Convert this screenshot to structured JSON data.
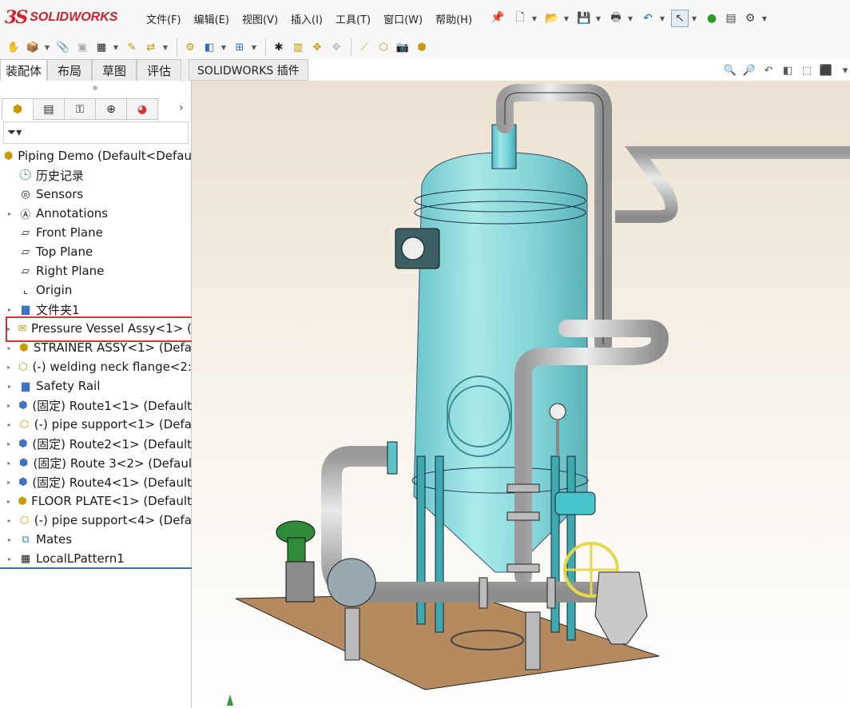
{
  "app": {
    "logo_ds": "3S",
    "logo_text": "SOLIDWORKS"
  },
  "menu": [
    "文件(F)",
    "编辑(E)",
    "视图(V)",
    "插入(I)",
    "工具(T)",
    "窗口(W)",
    "帮助(H)"
  ],
  "command_tabs": {
    "items": [
      "装配体",
      "布局",
      "草图",
      "评估"
    ],
    "plugins": "SOLIDWORKS 插件",
    "active": "装配体"
  },
  "panel": {
    "filter_icon": "filter-icon"
  },
  "tree": {
    "root": "Piping Demo  (Default<Defau",
    "items": [
      {
        "label": "历史记录",
        "icon": "history-icon",
        "expandable": false
      },
      {
        "label": "Sensors",
        "icon": "sensors-icon",
        "expandable": false
      },
      {
        "label": "Annotations",
        "icon": "annotations-icon",
        "expandable": true
      },
      {
        "label": "Front Plane",
        "icon": "plane-icon",
        "expandable": false
      },
      {
        "label": "Top Plane",
        "icon": "plane-icon",
        "expandable": false
      },
      {
        "label": "Right Plane",
        "icon": "plane-icon",
        "expandable": false
      },
      {
        "label": "Origin",
        "icon": "origin-icon",
        "expandable": false
      },
      {
        "label": "文件夹1",
        "icon": "folder-icon",
        "expandable": true
      },
      {
        "label": "Pressure Vessel Assy<1> (",
        "icon": "assembly-icon",
        "expandable": true
      },
      {
        "label": "STRAINER ASSY<1> (Defa",
        "icon": "assembly-icon",
        "expandable": true
      },
      {
        "label": "(-) welding neck flange<2:",
        "icon": "part-icon",
        "expandable": true
      },
      {
        "label": "Safety Rail",
        "icon": "folder-icon",
        "expandable": true
      },
      {
        "label": "(固定) Route1<1> (Default",
        "icon": "route-icon",
        "expandable": true
      },
      {
        "label": "(-) pipe support<1> (Defa",
        "icon": "part-icon",
        "expandable": true
      },
      {
        "label": "(固定) Route2<1> (Default",
        "icon": "route-icon",
        "expandable": true
      },
      {
        "label": "(固定) Route 3<2> (Defaul",
        "icon": "route-icon",
        "expandable": true
      },
      {
        "label": "(固定) Route4<1> (Default",
        "icon": "route-icon",
        "expandable": true
      },
      {
        "label": "FLOOR PLATE<1> (Default",
        "icon": "part-icon",
        "expandable": true
      },
      {
        "label": "(-) pipe support<4> (Defa",
        "icon": "part-icon",
        "expandable": true
      },
      {
        "label": "Mates",
        "icon": "mates-icon",
        "expandable": true
      },
      {
        "label": "LocalLPattern1",
        "icon": "pattern-icon",
        "expandable": true
      }
    ],
    "highlighted": "Pressure Vessel Assy<1> ("
  },
  "colors": {
    "highlight": "#e03030",
    "vessel": "#6fd0d4",
    "pipe": "#c9c9c9",
    "plate": "#b48a5e",
    "brand": "#d4202a"
  }
}
